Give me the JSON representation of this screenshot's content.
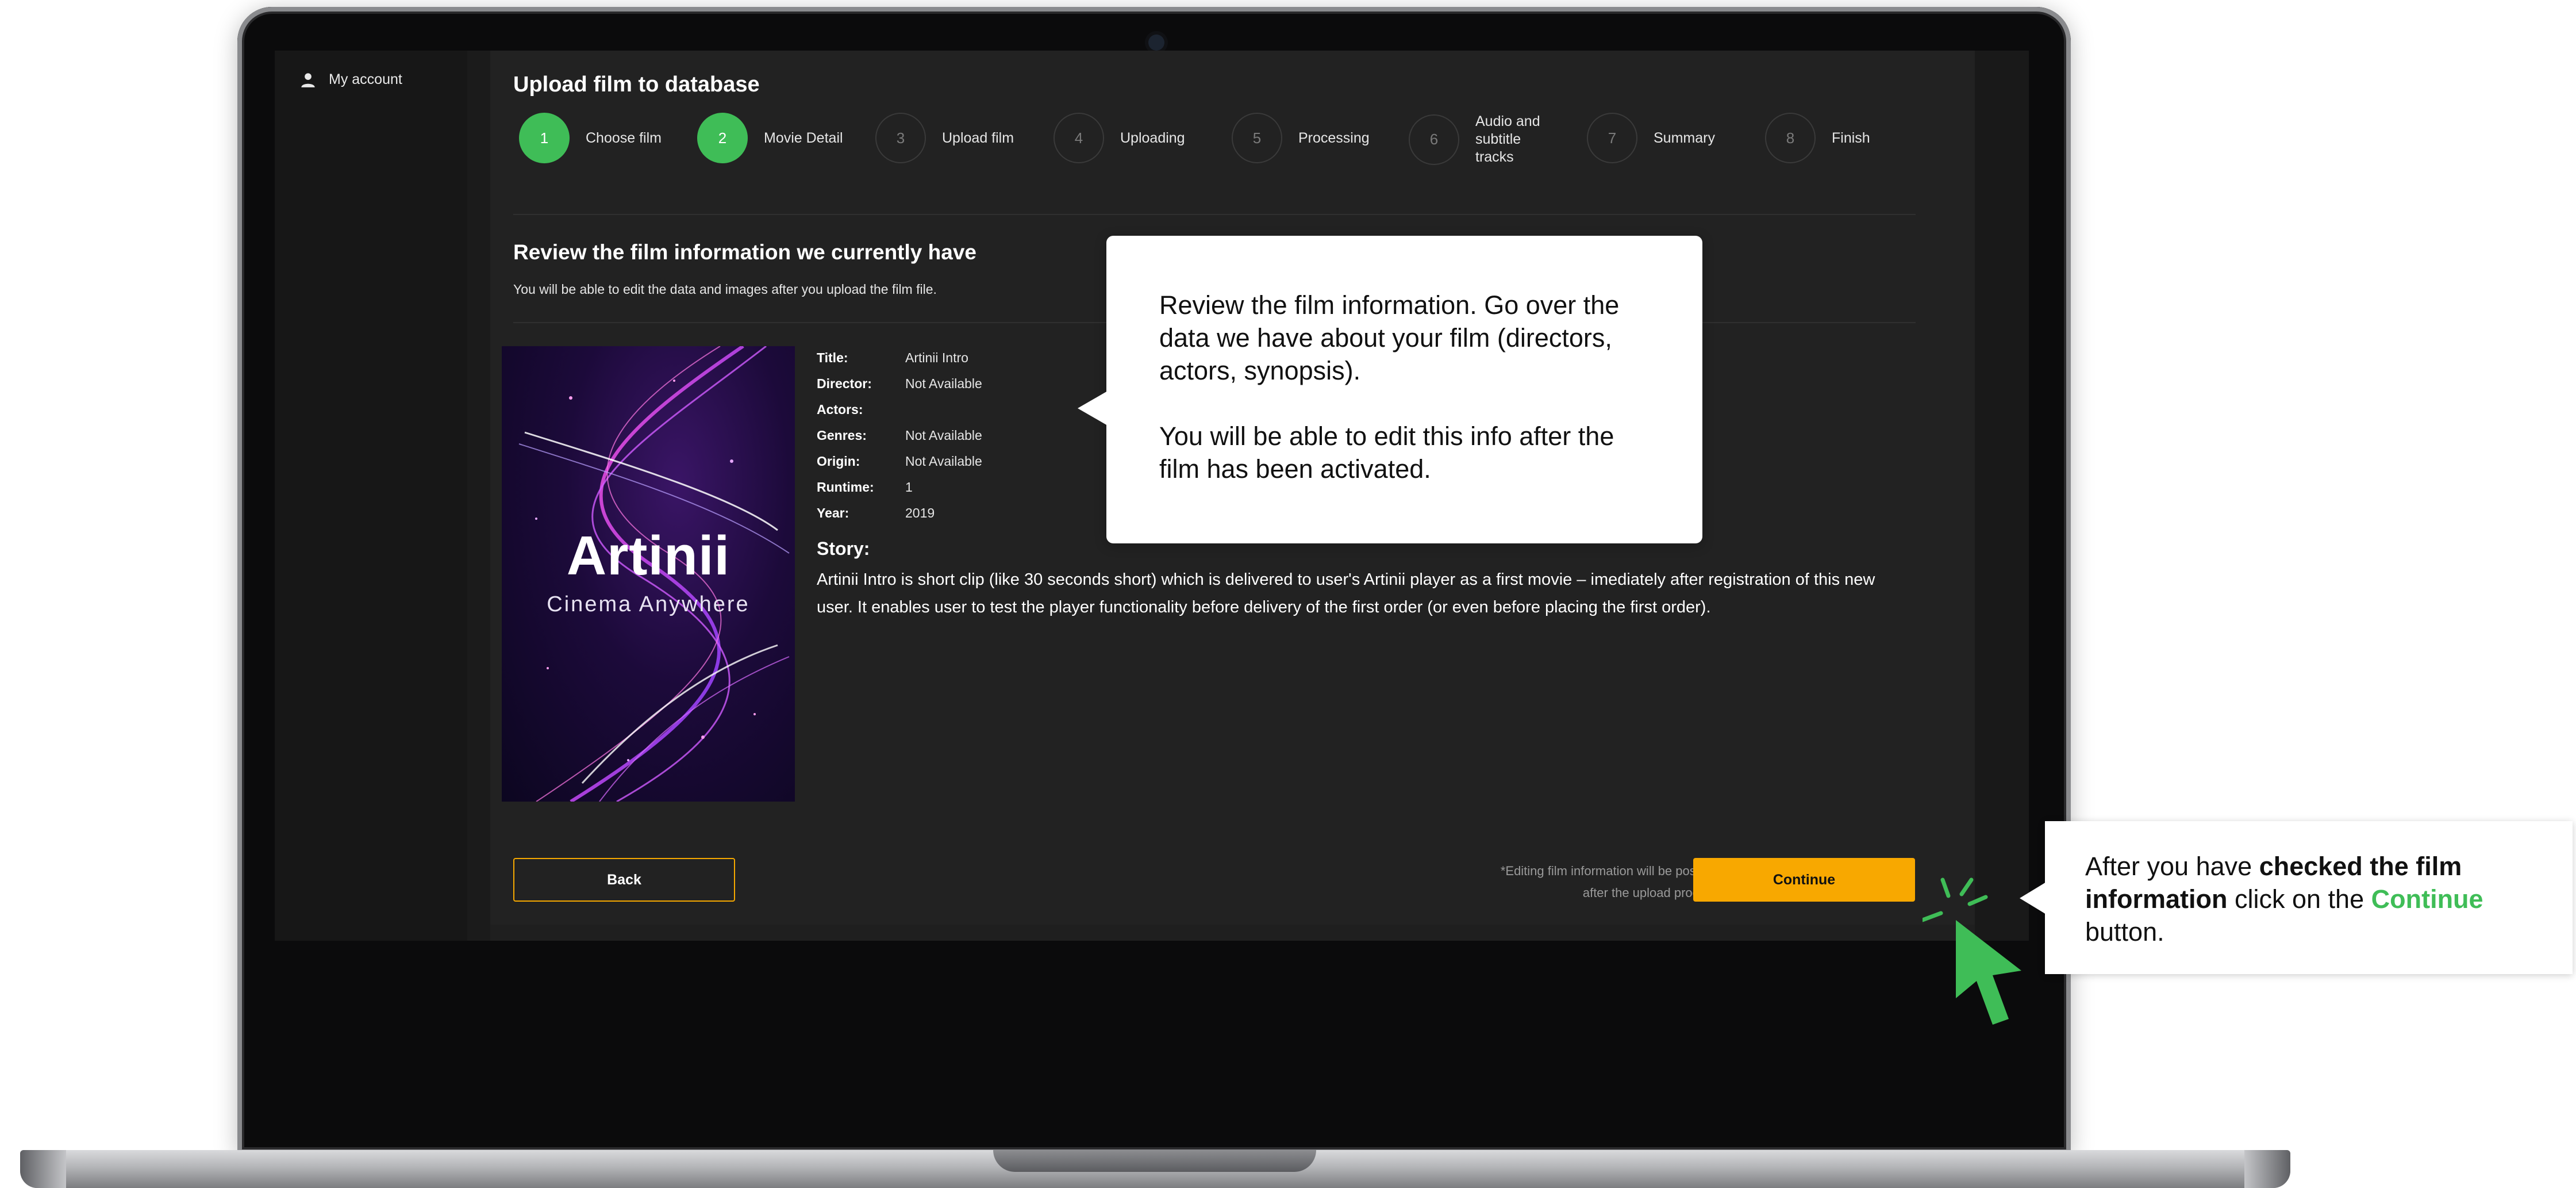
{
  "sidebar": {
    "items": [
      {
        "label": "My account",
        "icon": "user-icon"
      }
    ]
  },
  "page": {
    "title": "Upload film to database"
  },
  "steps": [
    {
      "number": "1",
      "label": "Choose film",
      "state": "completed"
    },
    {
      "number": "2",
      "label": "Movie Detail",
      "state": "active"
    },
    {
      "number": "3",
      "label": "Upload film",
      "state": "pending"
    },
    {
      "number": "4",
      "label": "Uploading",
      "state": "pending"
    },
    {
      "number": "5",
      "label": "Processing",
      "state": "pending"
    },
    {
      "number": "6",
      "label": "Audio and subtitle tracks",
      "state": "pending"
    },
    {
      "number": "7",
      "label": "Summary",
      "state": "pending"
    },
    {
      "number": "8",
      "label": "Finish",
      "state": "pending"
    }
  ],
  "review": {
    "title": "Review the film information we currently have",
    "subtitle": "You will be able to edit the data and images after you upload the film file."
  },
  "poster": {
    "title": "Artinii",
    "tagline": "Cinema Anywhere"
  },
  "film": {
    "fields": [
      {
        "label": "Title:",
        "value": "Artinii Intro"
      },
      {
        "label": "Director:",
        "value": "Not Available"
      },
      {
        "label": "Actors:",
        "value": ""
      },
      {
        "label": "Genres:",
        "value": "Not Available"
      },
      {
        "label": "Origin:",
        "value": "Not Available"
      },
      {
        "label": "Runtime:",
        "value": "1"
      },
      {
        "label": "Year:",
        "value": "2019"
      }
    ],
    "story_label": "Story:",
    "story": "Artinii Intro is short clip (like 30 seconds short) which is delivered to user's Artinii player as a first movie – imediately after registration of this new user. It enables user to test the player functionality before delivery of the first order (or even before placing the first order)."
  },
  "footer": {
    "back_label": "Back",
    "note_line1": "*Editing film information will be possible",
    "note_line2": "after the upload process.",
    "continue_label": "Continue"
  },
  "callouts": {
    "review_p1": "Review the film information. Go over the data we have about your film (directors, actors, synopsis).",
    "review_p2": "You will be able to edit this info after the film has been activated.",
    "continue_pre": "After you have ",
    "continue_bold": "checked the film information",
    "continue_mid": " click on the ",
    "continue_link": "Continue",
    "continue_post": " button."
  },
  "colors": {
    "accent_green": "#3fbd57",
    "continue_orange": "#f8a800",
    "panel_bg": "#222222"
  }
}
